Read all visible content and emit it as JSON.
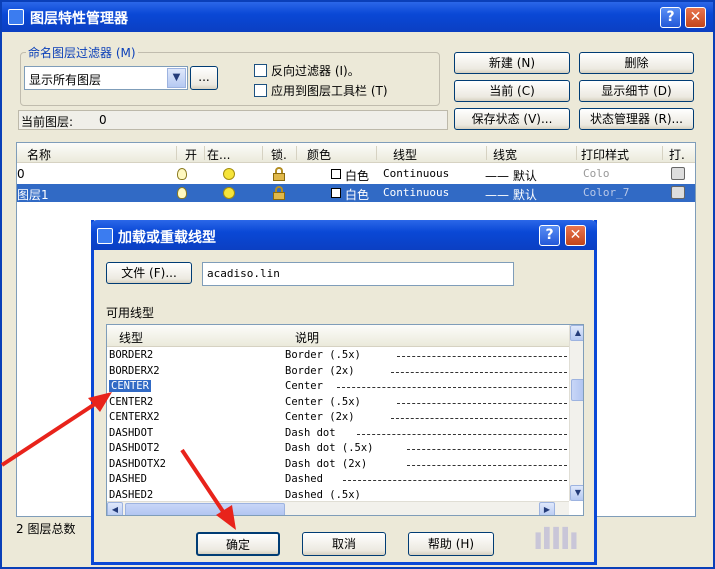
{
  "main_window": {
    "title": "图层特性管理器",
    "help_label": "?",
    "close_label": "✕",
    "filter_group_label": "命名图层过滤器 (M)",
    "filter_select_value": "显示所有图层",
    "dots_label": "...",
    "invert_filter_label": "反向过滤器 (I)。",
    "apply_toolbar_label": "应用到图层工具栏 (T)",
    "buttons": {
      "new": "新建 (N)",
      "delete": "删除",
      "current": "当前 (C)",
      "show_details": "显示细节 (D)",
      "save_state": "保存状态 (V)...",
      "state_manager": "状态管理器 (R)..."
    },
    "current_layer_label": "当前图层:",
    "current_layer_value": "0",
    "grid_headers": [
      "名称",
      "开",
      "在...",
      "锁.",
      "颜色",
      "线型",
      "线宽",
      "打印样式",
      "打."
    ],
    "layers": [
      {
        "name": "0",
        "color": "白色",
        "linetype": "Continuous",
        "lineweight": "—— 默认",
        "plot_style": "Colo"
      },
      {
        "name": "图层1",
        "color": "白色",
        "linetype": "Continuous",
        "lineweight": "—— 默认",
        "plot_style": "Color_7"
      }
    ],
    "status_text": "2 图层总数"
  },
  "dialog": {
    "title": "加载或重载线型",
    "help_label": "?",
    "close_label": "✕",
    "file_button": "文件 (F)...",
    "file_value": "acadiso.lin",
    "available_label": "可用线型",
    "col_linetype": "线型",
    "col_description": "说明",
    "rows": [
      {
        "name": "BORDER2",
        "desc": "Border (.5x)"
      },
      {
        "name": "BORDERX2",
        "desc": "Border (2x)"
      },
      {
        "name": "CENTER",
        "desc": "Center"
      },
      {
        "name": "CENTER2",
        "desc": "Center (.5x)"
      },
      {
        "name": "CENTERX2",
        "desc": "Center (2x)"
      },
      {
        "name": "DASHDOT",
        "desc": "Dash dot"
      },
      {
        "name": "DASHDOT2",
        "desc": "Dash dot (.5x)"
      },
      {
        "name": "DASHDOTX2",
        "desc": "Dash dot (2x)"
      },
      {
        "name": "DASHED",
        "desc": "Dashed"
      },
      {
        "name": "DASHED2",
        "desc": "Dashed (.5x)"
      }
    ],
    "selected_row": "CENTER",
    "ok_label": "确定",
    "cancel_label": "取消",
    "help_button": "帮助 (H)"
  },
  "colors": {
    "title_blue": "#0a48d6",
    "selection": "#316ac5",
    "annotation_arrow": "#e8231b"
  },
  "watermark": "ıIIIı"
}
